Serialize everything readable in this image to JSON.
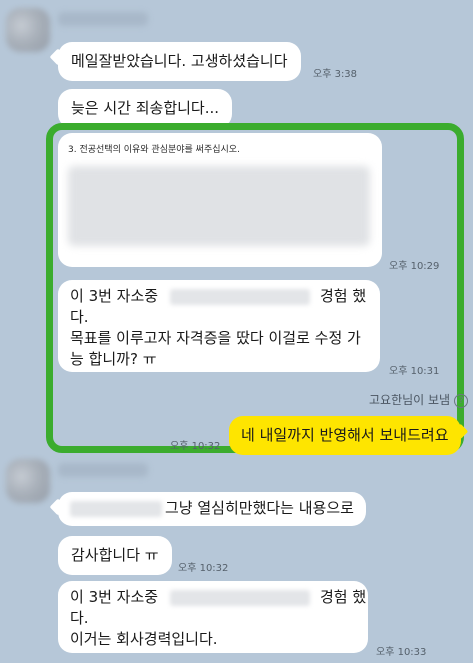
{
  "messages": {
    "m1": {
      "text": "메일잘받았습니다. 고생하셨습니다",
      "time": "오후 3:38"
    },
    "m2": {
      "text": "늦은 시간 죄송합니다..."
    },
    "m3": {
      "caption": "3. 전공선택의 이유와 관심분야를 써주십시오.",
      "time": "오후 10:29"
    },
    "m4": {
      "line1_start": "이 3번 자소중",
      "line1_end": "경험 했",
      "line2": "다.",
      "line3": "목표를 이루고자 자격증을 땄다 이걸로 수정 가",
      "line4": "능 합니까? ㅠ",
      "time": "오후 10:31"
    },
    "read_note": "고요한님이 보냄",
    "reply": {
      "text": "네 내일까지 반영해서 보내드려요",
      "time": "오후 10:32"
    },
    "m5": {
      "text": "그냥 열심히만했다는 내용으로"
    },
    "m6": {
      "text": "감사합니다 ㅠ",
      "time": "오후 10:32"
    },
    "m7": {
      "line1_start": "이 3번 자소중",
      "line1_end": "경험 했",
      "line2": "다.",
      "line3": "이거는 회사경력입니다.",
      "time": "오후 10:33"
    }
  },
  "colors": {
    "background": "#b6c7d8",
    "my_bubble": "#fee500",
    "highlight_border": "#3bac2e"
  }
}
